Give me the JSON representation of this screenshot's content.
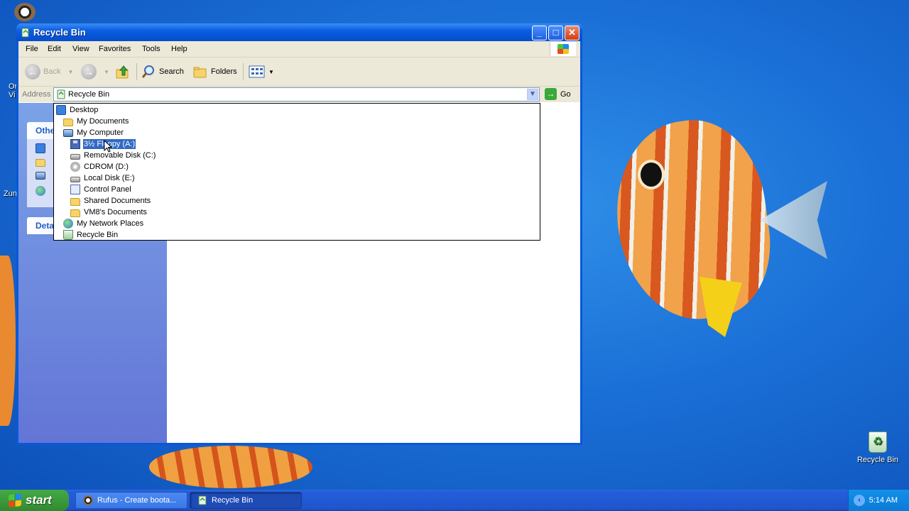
{
  "desktop": {
    "recycle_bin_label": "Recycle Bin",
    "partial_labels": [
      "Or",
      "Vi",
      "Zun"
    ]
  },
  "window": {
    "title": "Recycle Bin",
    "minimize": "_",
    "maximize": "□",
    "close": "✕"
  },
  "menu": {
    "items": [
      "File",
      "Edit",
      "View",
      "Favorites",
      "Tools",
      "Help"
    ]
  },
  "toolbar": {
    "back_label": "Back",
    "search_label": "Search",
    "folders_label": "Folders"
  },
  "address": {
    "label": "Address",
    "value": "Recycle Bin",
    "go_label": "Go"
  },
  "left_pane": {
    "other_places_title": "Othe",
    "details_title": "Deta"
  },
  "dropdown": {
    "items": [
      {
        "label": "Desktop",
        "icon": "desktop-icon",
        "level": 0
      },
      {
        "label": "My Documents",
        "icon": "folder-icon",
        "level": 1
      },
      {
        "label": "My Computer",
        "icon": "computer-icon",
        "level": 1
      },
      {
        "label": "3½ Floppy (A:)",
        "icon": "floppy-icon",
        "level": 2,
        "selected": true
      },
      {
        "label": "Removable Disk (C:)",
        "icon": "drive-icon",
        "level": 2
      },
      {
        "label": "CDROM (D:)",
        "icon": "cdrom-icon",
        "level": 2
      },
      {
        "label": "Local Disk (E:)",
        "icon": "drive-icon",
        "level": 2
      },
      {
        "label": "Control Panel",
        "icon": "control-panel-icon",
        "level": 2
      },
      {
        "label": "Shared Documents",
        "icon": "folder-icon",
        "level": 2
      },
      {
        "label": "VM8's Documents",
        "icon": "folder-icon",
        "level": 2
      },
      {
        "label": "My Network Places",
        "icon": "network-icon",
        "level": 1
      },
      {
        "label": "Recycle Bin",
        "icon": "recycle-bin-icon",
        "level": 1
      }
    ]
  },
  "taskbar": {
    "start_label": "start",
    "tasks": [
      {
        "label": "Rufus - Create boota...",
        "active": false
      },
      {
        "label": "Recycle Bin",
        "active": true
      }
    ],
    "clock": "5:14 AM"
  },
  "colors": {
    "selection": "#316ac5",
    "titlebar": "#0a5fe0",
    "start_green": "#3c9a3c"
  }
}
